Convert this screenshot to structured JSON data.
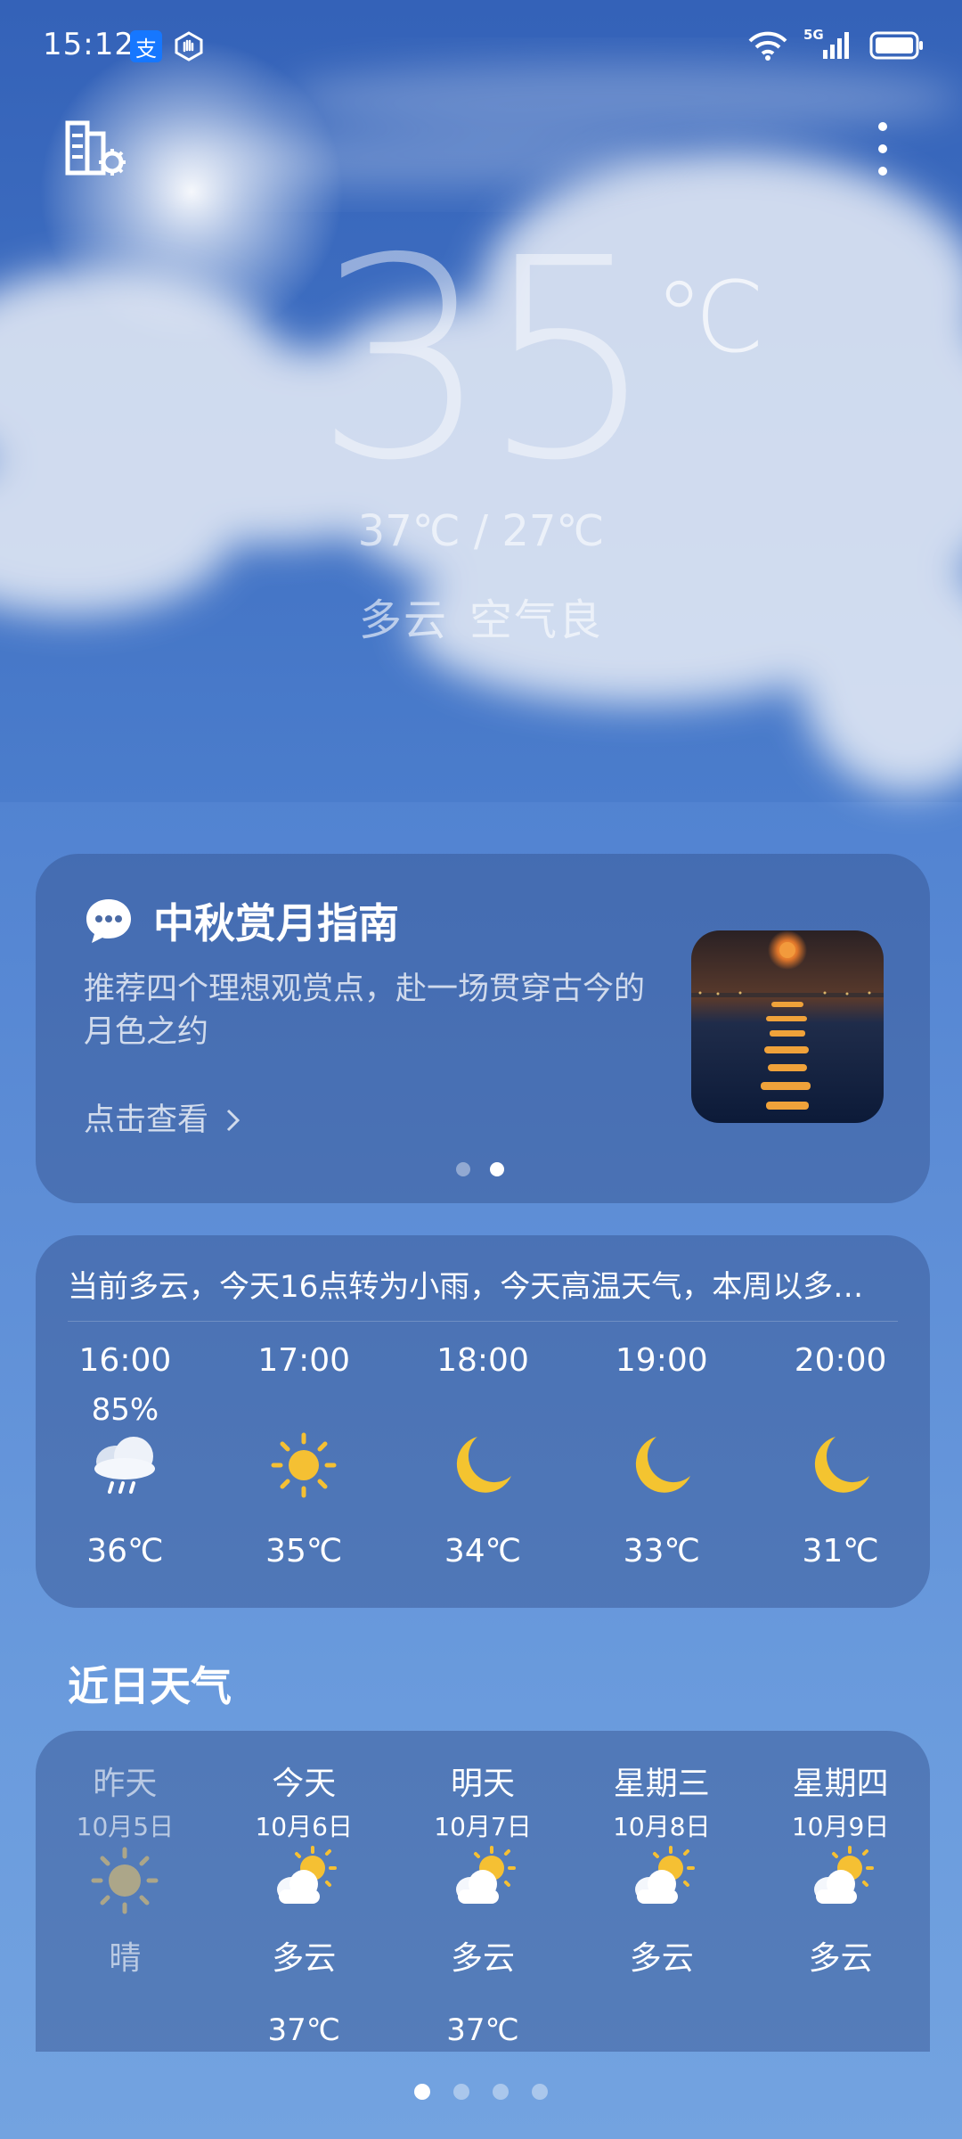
{
  "status_bar": {
    "time": "15:12",
    "network": "5G"
  },
  "current": {
    "temperature": "35",
    "unit": "℃",
    "range": "37℃ / 27℃",
    "condition": "多云",
    "air_quality": "空气良"
  },
  "promo": {
    "title": "中秋赏月指南",
    "description": "推荐四个理想观赏点，赴一场贯穿古今的月色之约",
    "link": "点击查看",
    "page": 2,
    "pages": 2
  },
  "hourly": {
    "summary": "当前多云，今天16点转为小雨，今天高温天气，本周以多…",
    "items": [
      {
        "time": "16:00",
        "precip": "85%",
        "icon": "rain-cloud-icon",
        "temp": "36℃"
      },
      {
        "time": "17:00",
        "precip": "",
        "icon": "sun-icon",
        "temp": "35℃"
      },
      {
        "time": "18:00",
        "precip": "",
        "icon": "moon-icon",
        "temp": "34℃"
      },
      {
        "time": "19:00",
        "precip": "",
        "icon": "moon-icon",
        "temp": "33℃"
      },
      {
        "time": "20:00",
        "precip": "",
        "icon": "moon-icon",
        "temp": "31℃"
      }
    ]
  },
  "daily": {
    "title": "近日天气",
    "items": [
      {
        "name": "昨天",
        "date": "10月5日",
        "icon": "sun-icon",
        "condition": "晴",
        "high": ""
      },
      {
        "name": "今天",
        "date": "10月6日",
        "icon": "partly-cloudy-icon",
        "condition": "多云",
        "high": "37℃"
      },
      {
        "name": "明天",
        "date": "10月7日",
        "icon": "partly-cloudy-icon",
        "condition": "多云",
        "high": "37℃"
      },
      {
        "name": "星期三",
        "date": "10月8日",
        "icon": "partly-cloudy-icon",
        "condition": "多云",
        "high": ""
      },
      {
        "name": "星期四",
        "date": "10月9日",
        "icon": "partly-cloudy-icon",
        "condition": "多云",
        "high": ""
      }
    ]
  },
  "pager": {
    "page": 1,
    "pages": 4
  },
  "colors": {
    "sun": "#f5c033",
    "moon": "#f4c430"
  }
}
